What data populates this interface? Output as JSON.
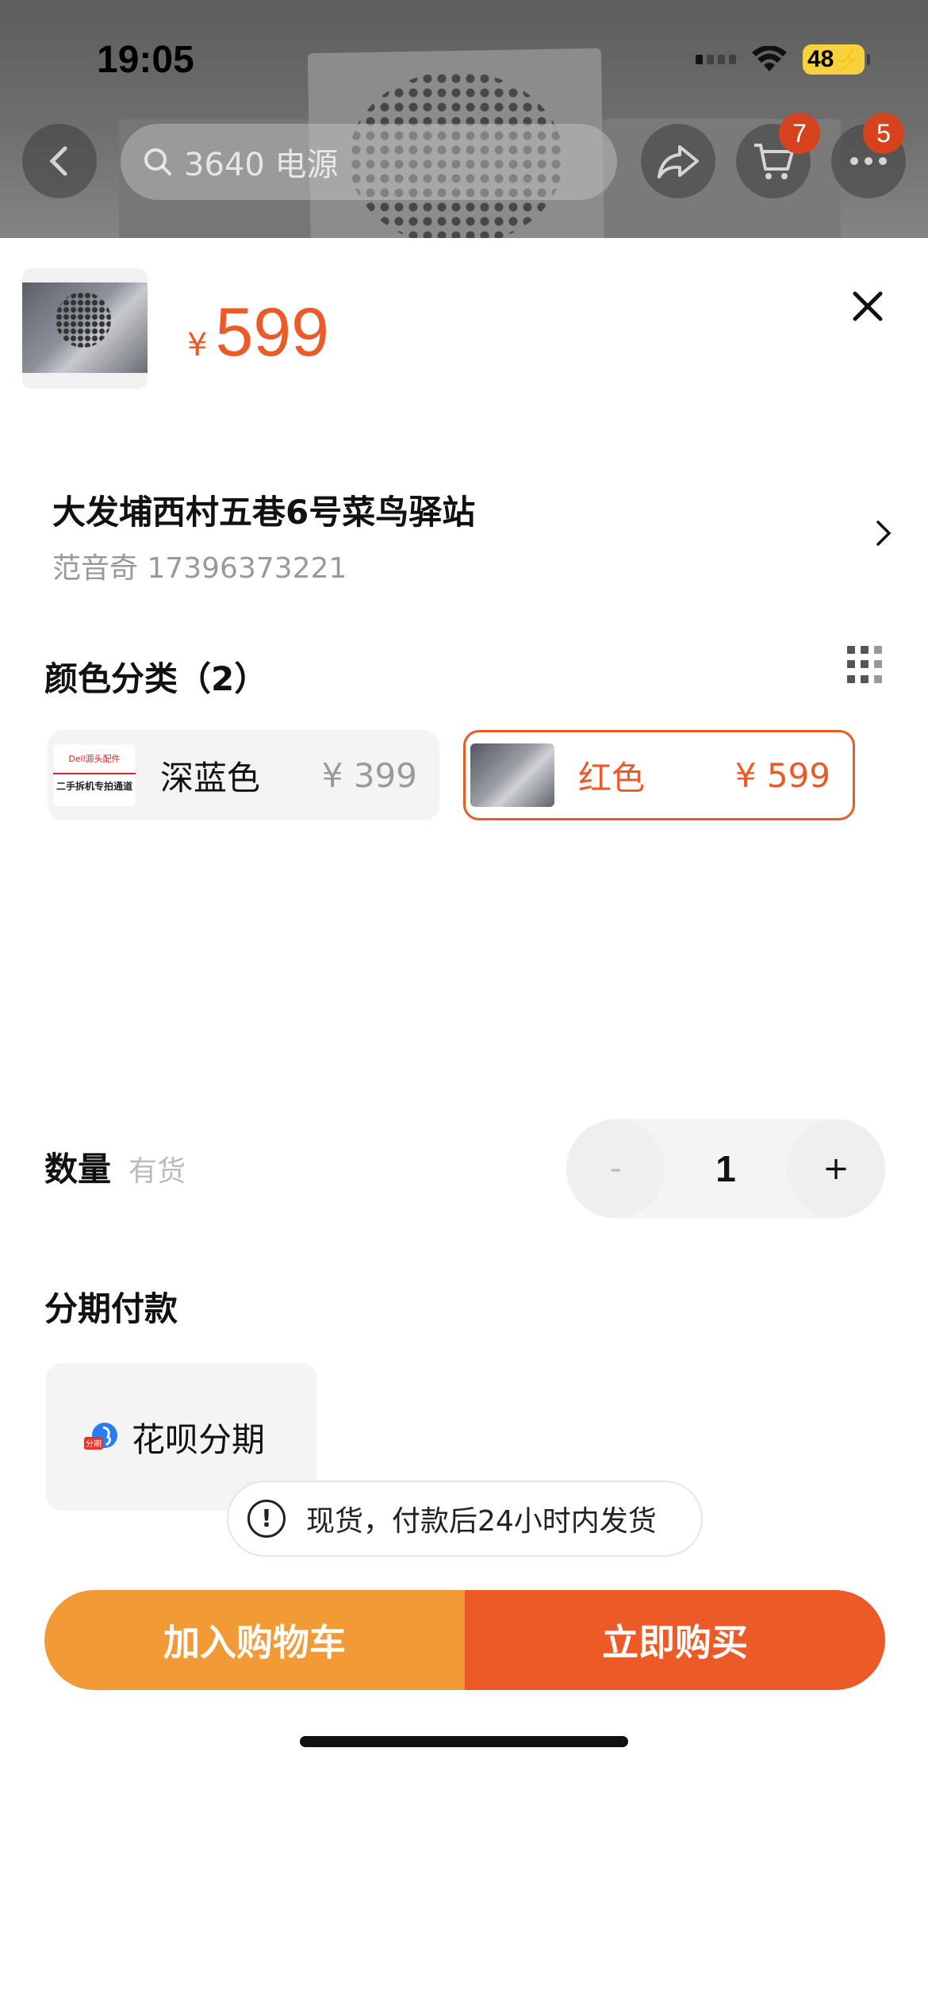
{
  "status_bar": {
    "time": "19:05",
    "battery": "48"
  },
  "header": {
    "search_placeholder": "3640 电源",
    "cart_badge": "7",
    "more_badge": "5"
  },
  "product": {
    "currency": "¥",
    "price": "599"
  },
  "address": {
    "line1": "大发埔西村五巷6号菜鸟驿站",
    "line2": "范音奇 17396373221"
  },
  "color_section": {
    "title": "颜色分类（2）",
    "options": [
      {
        "name": "深蓝色",
        "price": "¥ 399",
        "selected": false,
        "thumb_top": "Dell源头配件",
        "thumb_bottom": "二手拆机专拍通道"
      },
      {
        "name": "红色",
        "price": "¥ 599",
        "selected": true
      }
    ]
  },
  "quantity": {
    "label": "数量",
    "stock": "有货",
    "minus": "-",
    "value": "1",
    "plus": "+"
  },
  "installment": {
    "title": "分期付款",
    "option": "花呗分期",
    "badge": "分期"
  },
  "notice": "现货，付款后24小时内发货",
  "actions": {
    "add_to_cart": "加入购物车",
    "buy_now": "立即购买"
  },
  "colors": {
    "accent": "#ec5a28",
    "cart": "#f29a36"
  }
}
